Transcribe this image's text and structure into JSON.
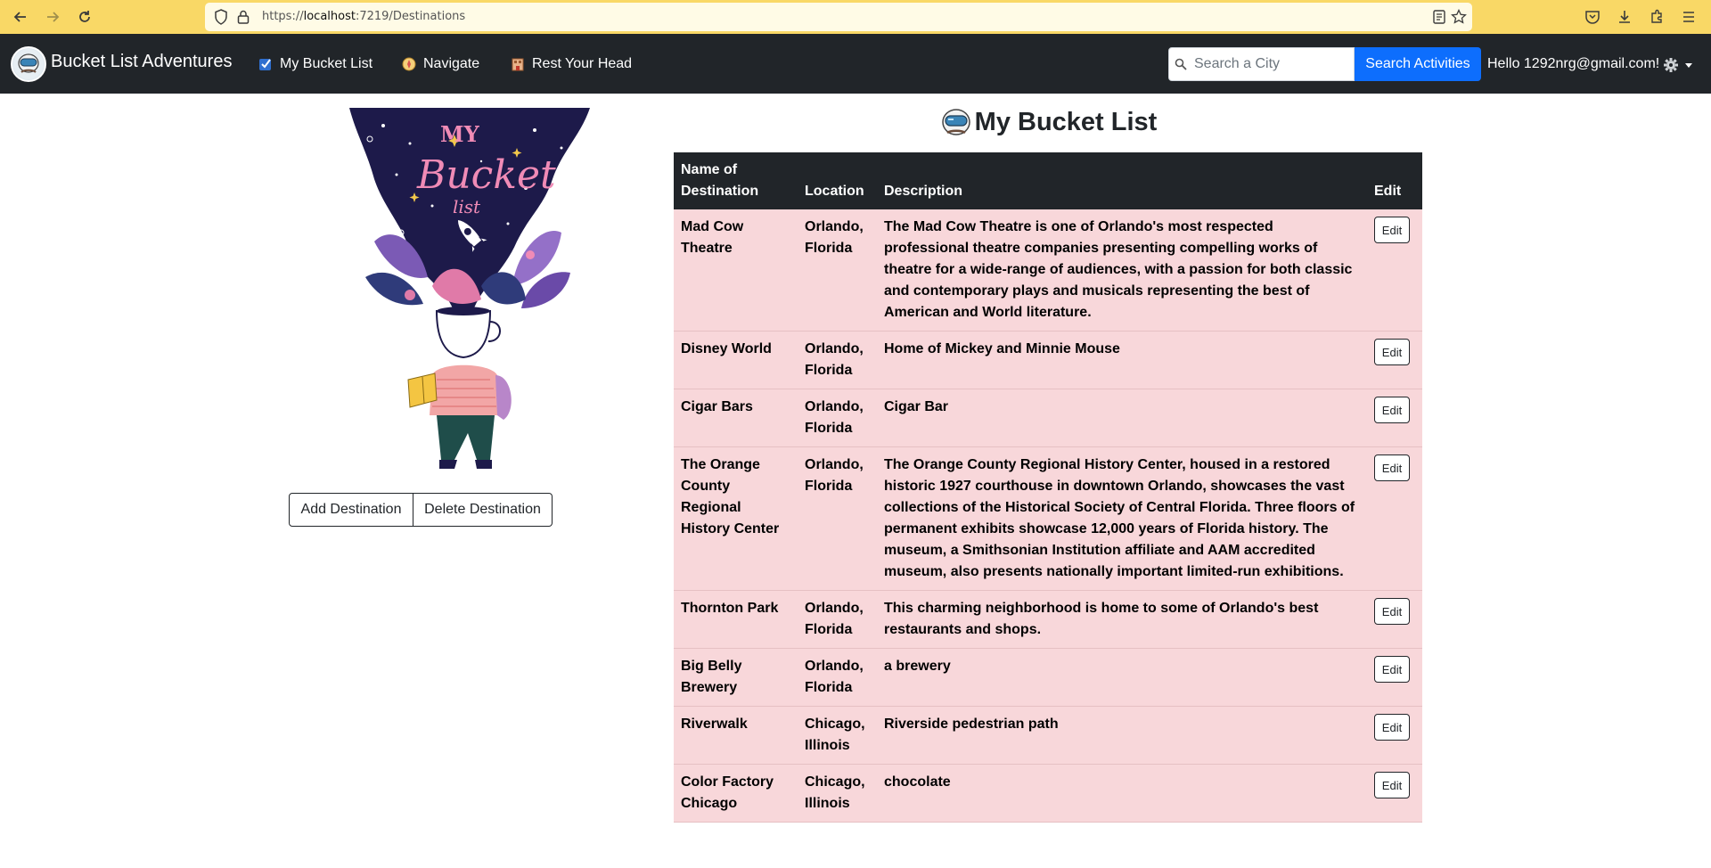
{
  "browser": {
    "url_prefix": "https://",
    "url_host": "localhost",
    "url_rest": ":7219/Destinations"
  },
  "navbar": {
    "brand": "Bucket List Adventures",
    "links": [
      {
        "label": "My Bucket List",
        "icon": "checkmark-icon"
      },
      {
        "label": "Navigate",
        "icon": "compass-icon"
      },
      {
        "label": "Rest Your Head",
        "icon": "hotel-icon"
      }
    ],
    "search_placeholder": "Search a City",
    "search_button": "Search Activities",
    "greeting": "Hello 1292nrg@gmail.com!"
  },
  "actions": {
    "add": "Add Destination",
    "delete": "Delete Destination"
  },
  "hero": {
    "lettering": [
      "MY",
      "Bucket",
      "list"
    ]
  },
  "main": {
    "title": "My Bucket List"
  },
  "table": {
    "headers": [
      "Name of Destination",
      "Location",
      "Description",
      "Edit"
    ],
    "edit_label": "Edit",
    "rows": [
      {
        "name": "Mad Cow Theatre",
        "location": "Orlando, Florida",
        "description": "The Mad Cow Theatre is one of Orlando's most respected professional theatre companies presenting compelling works of theatre for a wide-range of audiences, with a passion for both classic and contemporary plays and musicals representing the best of American and World literature."
      },
      {
        "name": "Disney World",
        "location": "Orlando, Florida",
        "description": "Home of Mickey and Minnie Mouse"
      },
      {
        "name": "Cigar Bars",
        "location": "Orlando, Florida",
        "description": "Cigar Bar"
      },
      {
        "name": "The Orange County Regional History Center",
        "location": "Orlando, Florida",
        "description": "The Orange County Regional History Center, housed in a restored historic 1927 courthouse in downtown Orlando, showcases the vast collections of the Historical Society of Central Florida. Three floors of permanent exhibits showcase 12,000 years of Florida history. The museum, a Smithsonian Institution affiliate and AAM accredited museum, also presents nationally important limited-run exhibitions."
      },
      {
        "name": "Thornton Park",
        "location": "Orlando, Florida",
        "description": "This charming neighborhood is home to some of Orlando's best restaurants and shops."
      },
      {
        "name": "Big Belly Brewery",
        "location": "Orlando, Florida",
        "description": "a brewery"
      },
      {
        "name": "Riverwalk",
        "location": "Chicago, Illinois",
        "description": "Riverside pedestrian path"
      },
      {
        "name": "Color Factory Chicago",
        "location": "Chicago, Illinois",
        "description": "chocolate"
      }
    ]
  },
  "colors": {
    "browser_bar": "#f9d866",
    "navbar": "#212529",
    "primary": "#0d6efd",
    "row_bg": "#f8d7da"
  }
}
